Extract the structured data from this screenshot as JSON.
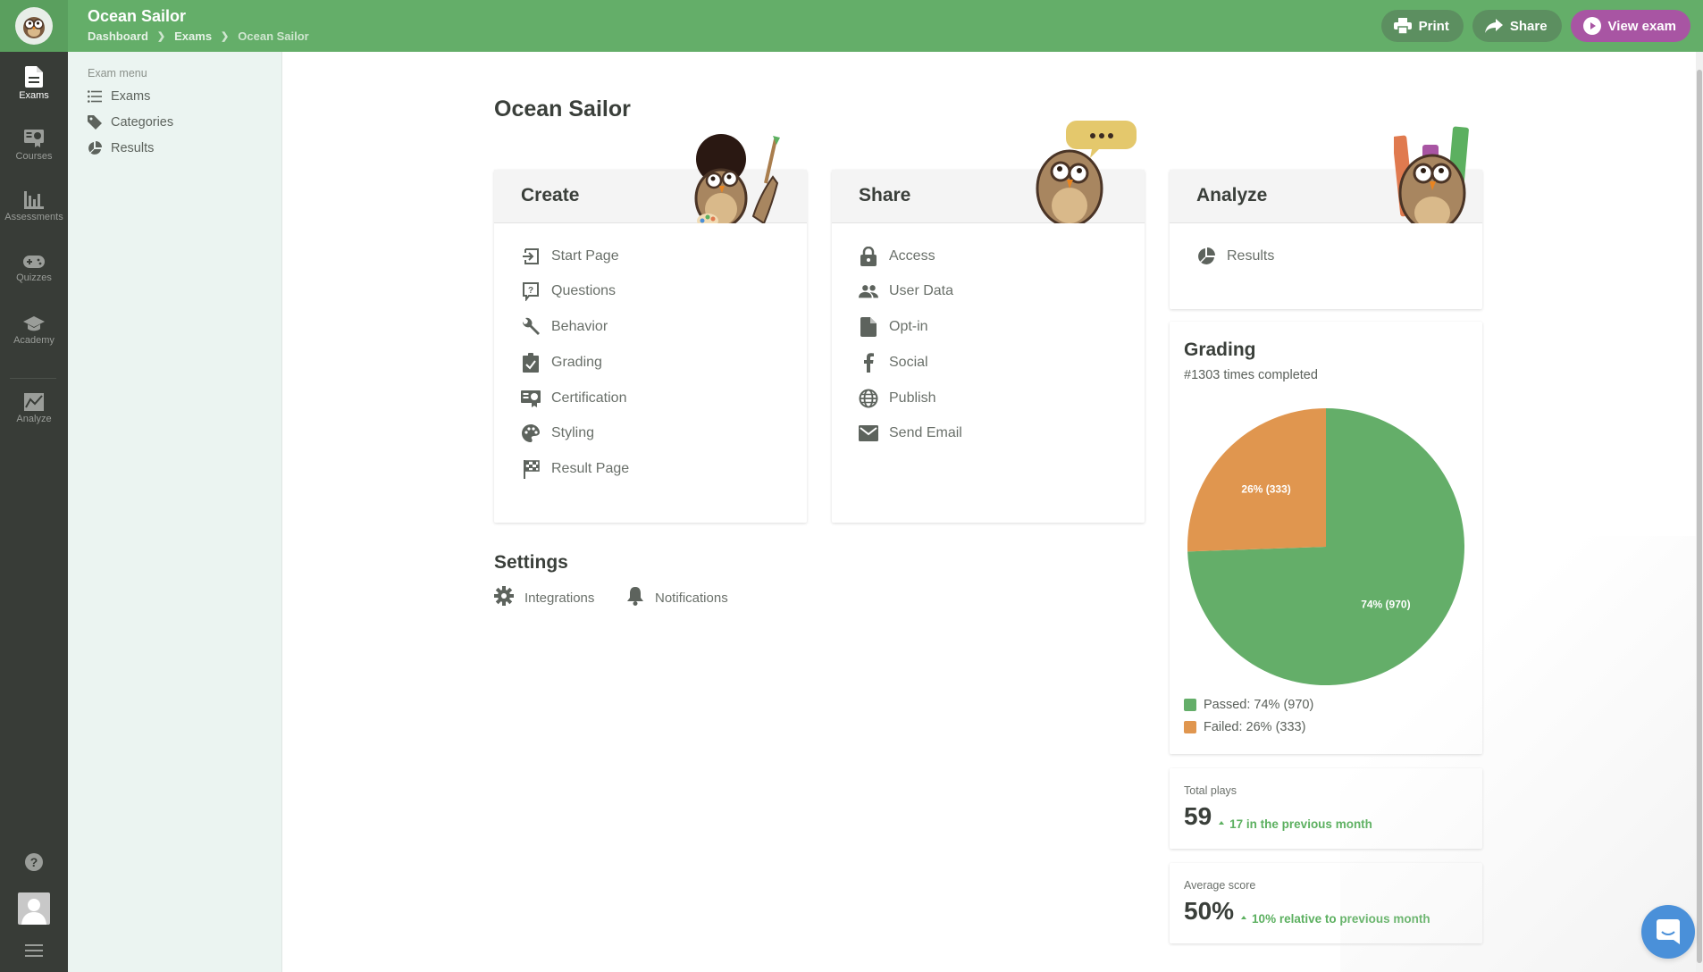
{
  "header": {
    "title": "Ocean Sailor",
    "breadcrumb": [
      "Dashboard",
      "Exams",
      "Ocean Sailor"
    ],
    "actions": {
      "print": "Print",
      "share": "Share",
      "view_exam": "View exam"
    }
  },
  "rail": {
    "items": [
      {
        "label": "Exams",
        "icon": "document-icon",
        "active": true
      },
      {
        "label": "Courses",
        "icon": "certificate-icon"
      },
      {
        "label": "Assessments",
        "icon": "bar-chart-icon"
      },
      {
        "label": "Quizzes",
        "icon": "gamepad-icon"
      },
      {
        "label": "Academy",
        "icon": "graduation-cap-icon"
      },
      {
        "label": "Analyze",
        "icon": "line-chart-icon"
      }
    ],
    "bottom": [
      "help-icon",
      "avatar",
      "hamburger-menu-icon"
    ]
  },
  "submenu": {
    "title": "Exam menu",
    "items": [
      {
        "label": "Exams",
        "icon": "list-icon"
      },
      {
        "label": "Categories",
        "icon": "tag-icon"
      },
      {
        "label": "Results",
        "icon": "pie-chart-icon"
      }
    ]
  },
  "main": {
    "title": "Ocean Sailor",
    "create": {
      "title": "Create",
      "items": [
        {
          "label": "Start Page",
          "icon": "sign-in-icon"
        },
        {
          "label": "Questions",
          "icon": "question-bubble-icon"
        },
        {
          "label": "Behavior",
          "icon": "wrench-icon"
        },
        {
          "label": "Grading",
          "icon": "clipboard-check-icon"
        },
        {
          "label": "Certification",
          "icon": "certificate-icon"
        },
        {
          "label": "Styling",
          "icon": "palette-icon"
        },
        {
          "label": "Result Page",
          "icon": "checkered-flag-icon"
        }
      ]
    },
    "share": {
      "title": "Share",
      "items": [
        {
          "label": "Access",
          "icon": "lock-icon"
        },
        {
          "label": "User Data",
          "icon": "users-icon"
        },
        {
          "label": "Opt-in",
          "icon": "file-icon"
        },
        {
          "label": "Social",
          "icon": "facebook-icon"
        },
        {
          "label": "Publish",
          "icon": "globe-icon"
        },
        {
          "label": "Send Email",
          "icon": "envelope-icon"
        }
      ]
    },
    "analyze": {
      "title": "Analyze",
      "items": [
        {
          "label": "Results",
          "icon": "pie-chart-icon"
        }
      ]
    },
    "settings": {
      "title": "Settings",
      "items": [
        {
          "label": "Integrations",
          "icon": "gear-icon"
        },
        {
          "label": "Notifications",
          "icon": "bell-icon"
        }
      ]
    },
    "grading": {
      "title": "Grading",
      "subtitle": "#1303 times completed",
      "legend": [
        {
          "label": "Passed: 74% (970)",
          "color": "#64ae69"
        },
        {
          "label": "Failed: 26% (333)",
          "color": "#e0964f"
        }
      ]
    },
    "total_plays": {
      "label": "Total plays",
      "value": "59",
      "delta": "17 in the previous month"
    },
    "average_score": {
      "label": "Average score",
      "value": "50%",
      "delta": "10% relative to previous month"
    }
  },
  "chart_data": {
    "type": "pie",
    "title": "Grading",
    "categories": [
      "Passed",
      "Failed"
    ],
    "values": [
      970,
      333
    ],
    "percentages": [
      74,
      26
    ],
    "labels": [
      "74% (970)",
      "26% (333)"
    ],
    "colors": [
      "#64ae69",
      "#e0964f"
    ],
    "legend": "bottom-left",
    "start_angle": "12 o'clock, clockwise"
  },
  "colors": {
    "header": "#64ae69",
    "rail": "#383c37",
    "submenu": "#ebf4f1",
    "accent_purple": "#a855a3",
    "positive": "#5cb060",
    "chat": "#4a90d9"
  }
}
